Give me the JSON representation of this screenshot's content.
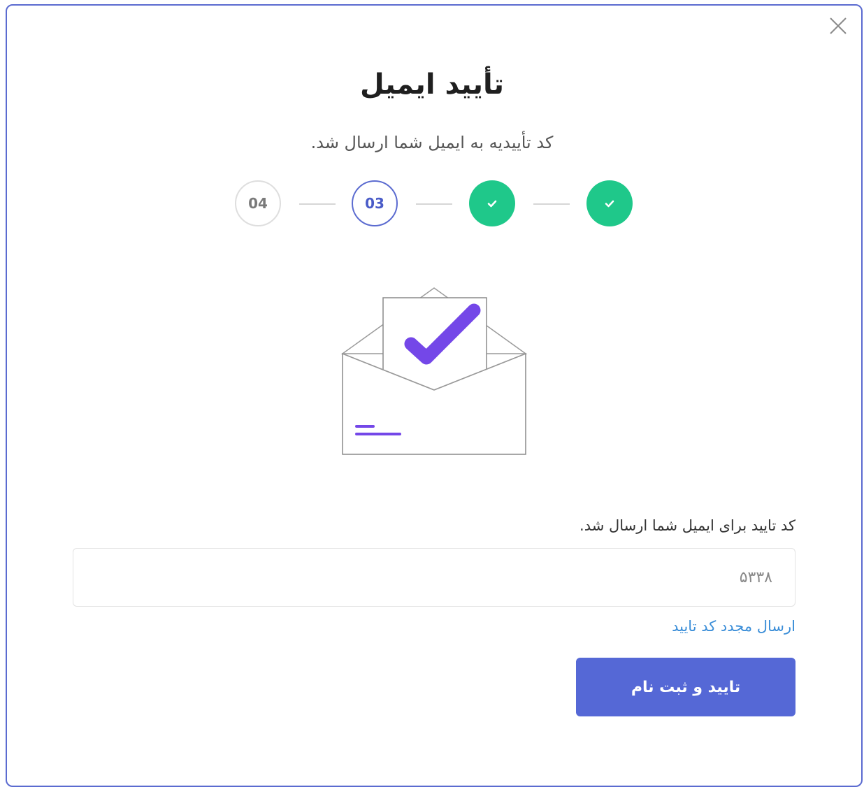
{
  "dialog": {
    "title": "تأیید ایمیل",
    "subtitle": "کد تأییدیه به ایمیل شما ارسال شد."
  },
  "steps": [
    {
      "label": "04",
      "state": "pending"
    },
    {
      "label": "03",
      "state": "current"
    },
    {
      "label": "",
      "state": "done",
      "icon": "check-icon"
    },
    {
      "label": "",
      "state": "done",
      "icon": "check-icon"
    }
  ],
  "form": {
    "code_label": "کد تایید برای ایمیل شما ارسال شد.",
    "code_value": "۵۳۳۸",
    "resend_link": "ارسال مجدد کد تایید",
    "submit_label": "تایید و ثبت نام"
  },
  "colors": {
    "accent": "#5568d6",
    "success": "#1fc88a",
    "link": "#3b8ed8",
    "illustration_check": "#7447e8"
  },
  "icons": {
    "close": "close-icon",
    "illustration": "envelope-check-illustration"
  }
}
